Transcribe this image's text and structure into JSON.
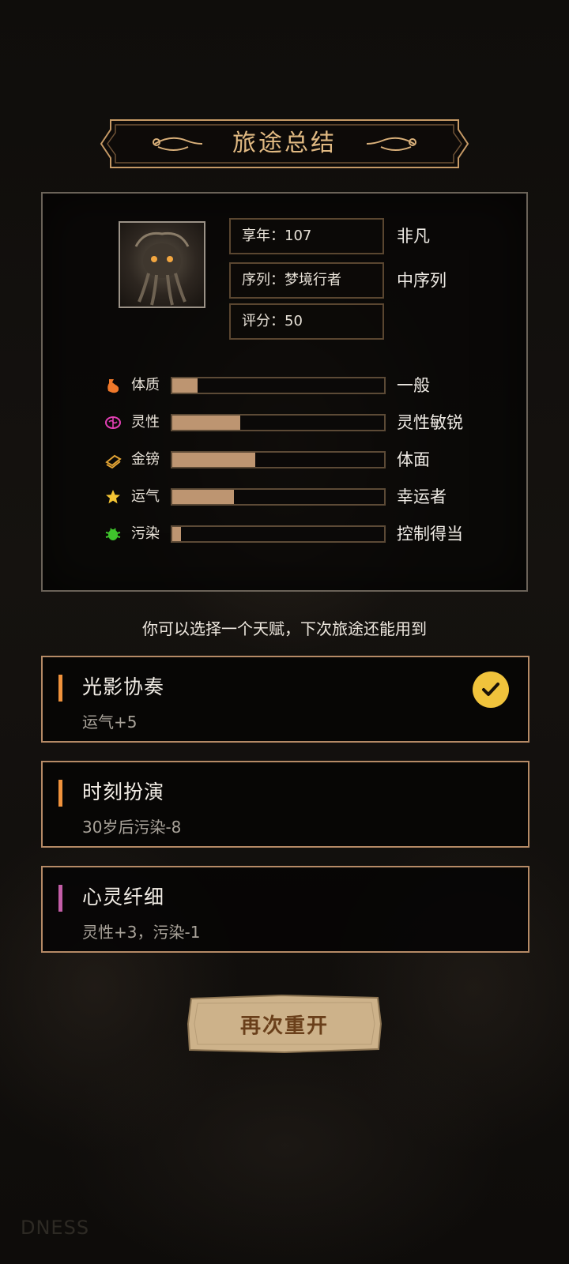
{
  "title": "旅途总结",
  "summary": {
    "age_label": "享年：107",
    "age_rank": "非凡",
    "sequence_label": "序列：梦境行者",
    "sequence_rank": "中序列",
    "score_label": "评分：50"
  },
  "stats": [
    {
      "label": "体质",
      "icon": "muscle-arm-icon",
      "icon_color": "#f0782a",
      "level": 0.12,
      "desc": "一般"
    },
    {
      "label": "灵性",
      "icon": "brain-icon",
      "icon_color": "#e23fb4",
      "level": 0.32,
      "desc": "灵性敏锐"
    },
    {
      "label": "金镑",
      "icon": "money-icon",
      "icon_color": "#e0a234",
      "level": 0.39,
      "desc": "体面"
    },
    {
      "label": "运气",
      "icon": "star-icon",
      "icon_color": "#f4c534",
      "level": 0.29,
      "desc": "幸运者"
    },
    {
      "label": "污染",
      "icon": "bug-icon",
      "icon_color": "#3fc42c",
      "level": 0.04,
      "desc": "控制得当"
    }
  ],
  "prompt": "你可以选择一个天赋，下次旅途还能用到",
  "talents": [
    {
      "name": "光影协奏",
      "effect": "运气+5",
      "accent": "#f0923c",
      "selected": true
    },
    {
      "name": "时刻扮演",
      "effect": "30岁后污染-8",
      "accent": "#f0923c",
      "selected": false
    },
    {
      "name": "心灵纤细",
      "effect": "灵性+3，污染-1",
      "accent": "#c45ea8",
      "selected": false
    }
  ],
  "restart_label": "再次重开",
  "watermark": "DNESS"
}
